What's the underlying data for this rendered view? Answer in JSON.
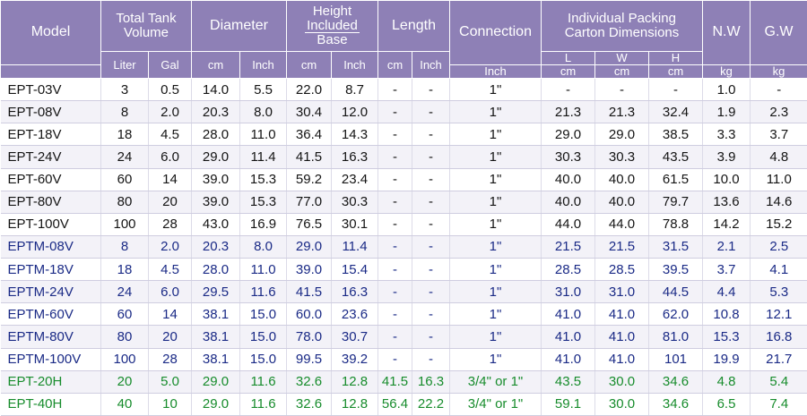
{
  "header": {
    "model": "Model",
    "volume": "Total Tank Volume",
    "diameter": "Diameter",
    "height_line1": "Height",
    "height_line2": "Included",
    "height_line3": "Base",
    "length": "Length",
    "connection": "Connection",
    "packing_line1": "Individual Packing",
    "packing_line2": "Carton Dimensions",
    "nw": "N.W",
    "gw": "G.W",
    "pack_l": "L",
    "pack_w": "W",
    "pack_h": "H",
    "units": [
      "Liter",
      "Gal",
      "cm",
      "Inch",
      "cm",
      "Inch",
      "cm",
      "Inch",
      "Inch",
      "cm",
      "cm",
      "cm",
      "kg",
      "kg"
    ]
  },
  "rows": [
    {
      "model": "EPT-03V",
      "liter": "3",
      "gal": "0.5",
      "dia_cm": "14.0",
      "dia_inch": "5.5",
      "h_cm": "22.0",
      "h_inch": "8.7",
      "len_cm": "-",
      "len_inch": "-",
      "conn": "1\"",
      "pl": "-",
      "pw": "-",
      "ph": "-",
      "nw": "1.0",
      "gw": "-",
      "group": "black"
    },
    {
      "model": "EPT-08V",
      "liter": "8",
      "gal": "2.0",
      "dia_cm": "20.3",
      "dia_inch": "8.0",
      "h_cm": "30.4",
      "h_inch": "12.0",
      "len_cm": "-",
      "len_inch": "-",
      "conn": "1\"",
      "pl": "21.3",
      "pw": "21.3",
      "ph": "32.4",
      "nw": "1.9",
      "gw": "2.3",
      "group": "black"
    },
    {
      "model": "EPT-18V",
      "liter": "18",
      "gal": "4.5",
      "dia_cm": "28.0",
      "dia_inch": "11.0",
      "h_cm": "36.4",
      "h_inch": "14.3",
      "len_cm": "-",
      "len_inch": "-",
      "conn": "1\"",
      "pl": "29.0",
      "pw": "29.0",
      "ph": "38.5",
      "nw": "3.3",
      "gw": "3.7",
      "group": "black"
    },
    {
      "model": "EPT-24V",
      "liter": "24",
      "gal": "6.0",
      "dia_cm": "29.0",
      "dia_inch": "11.4",
      "h_cm": "41.5",
      "h_inch": "16.3",
      "len_cm": "-",
      "len_inch": "-",
      "conn": "1\"",
      "pl": "30.3",
      "pw": "30.3",
      "ph": "43.5",
      "nw": "3.9",
      "gw": "4.8",
      "group": "black"
    },
    {
      "model": "EPT-60V",
      "liter": "60",
      "gal": "14",
      "dia_cm": "39.0",
      "dia_inch": "15.3",
      "h_cm": "59.2",
      "h_inch": "23.4",
      "len_cm": "-",
      "len_inch": "-",
      "conn": "1\"",
      "pl": "40.0",
      "pw": "40.0",
      "ph": "61.5",
      "nw": "10.0",
      "gw": "11.0",
      "group": "black"
    },
    {
      "model": "EPT-80V",
      "liter": "80",
      "gal": "20",
      "dia_cm": "39.0",
      "dia_inch": "15.3",
      "h_cm": "77.0",
      "h_inch": "30.3",
      "len_cm": "-",
      "len_inch": "-",
      "conn": "1\"",
      "pl": "40.0",
      "pw": "40.0",
      "ph": "79.7",
      "nw": "13.6",
      "gw": "14.6",
      "group": "black"
    },
    {
      "model": "EPT-100V",
      "liter": "100",
      "gal": "28",
      "dia_cm": "43.0",
      "dia_inch": "16.9",
      "h_cm": "76.5",
      "h_inch": "30.1",
      "len_cm": "-",
      "len_inch": "-",
      "conn": "1\"",
      "pl": "44.0",
      "pw": "44.0",
      "ph": "78.8",
      "nw": "14.2",
      "gw": "15.2",
      "group": "black"
    },
    {
      "model": "EPTM-08V",
      "liter": "8",
      "gal": "2.0",
      "dia_cm": "20.3",
      "dia_inch": "8.0",
      "h_cm": "29.0",
      "h_inch": "11.4",
      "len_cm": "-",
      "len_inch": "-",
      "conn": "1\"",
      "pl": "21.5",
      "pw": "21.5",
      "ph": "31.5",
      "nw": "2.1",
      "gw": "2.5",
      "group": "blue"
    },
    {
      "model": "EPTM-18V",
      "liter": "18",
      "gal": "4.5",
      "dia_cm": "28.0",
      "dia_inch": "11.0",
      "h_cm": "39.0",
      "h_inch": "15.4",
      "len_cm": "-",
      "len_inch": "-",
      "conn": "1\"",
      "pl": "28.5",
      "pw": "28.5",
      "ph": "39.5",
      "nw": "3.7",
      "gw": "4.1",
      "group": "blue"
    },
    {
      "model": "EPTM-24V",
      "liter": "24",
      "gal": "6.0",
      "dia_cm": "29.5",
      "dia_inch": "11.6",
      "h_cm": "41.5",
      "h_inch": "16.3",
      "len_cm": "-",
      "len_inch": "-",
      "conn": "1\"",
      "pl": "31.0",
      "pw": "31.0",
      "ph": "44.5",
      "nw": "4.4",
      "gw": "5.3",
      "group": "blue"
    },
    {
      "model": "EPTM-60V",
      "liter": "60",
      "gal": "14",
      "dia_cm": "38.1",
      "dia_inch": "15.0",
      "h_cm": "60.0",
      "h_inch": "23.6",
      "len_cm": "-",
      "len_inch": "-",
      "conn": "1\"",
      "pl": "41.0",
      "pw": "41.0",
      "ph": "62.0",
      "nw": "10.8",
      "gw": "12.1",
      "group": "blue"
    },
    {
      "model": "EPTM-80V",
      "liter": "80",
      "gal": "20",
      "dia_cm": "38.1",
      "dia_inch": "15.0",
      "h_cm": "78.0",
      "h_inch": "30.7",
      "len_cm": "-",
      "len_inch": "-",
      "conn": "1\"",
      "pl": "41.0",
      "pw": "41.0",
      "ph": "81.0",
      "nw": "15.3",
      "gw": "16.8",
      "group": "blue"
    },
    {
      "model": "EPTM-100V",
      "liter": "100",
      "gal": "28",
      "dia_cm": "38.1",
      "dia_inch": "15.0",
      "h_cm": "99.5",
      "h_inch": "39.2",
      "len_cm": "-",
      "len_inch": "-",
      "conn": "1\"",
      "pl": "41.0",
      "pw": "41.0",
      "ph": "101",
      "nw": "19.9",
      "gw": "21.7",
      "group": "blue"
    },
    {
      "model": "EPT-20H",
      "liter": "20",
      "gal": "5.0",
      "dia_cm": "29.0",
      "dia_inch": "11.6",
      "h_cm": "32.6",
      "h_inch": "12.8",
      "len_cm": "41.5",
      "len_inch": "16.3",
      "conn": "3/4\" or 1\"",
      "pl": "43.5",
      "pw": "30.0",
      "ph": "34.6",
      "nw": "4.8",
      "gw": "5.4",
      "group": "green"
    },
    {
      "model": "EPT-40H",
      "liter": "40",
      "gal": "10",
      "dia_cm": "29.0",
      "dia_inch": "11.6",
      "h_cm": "32.6",
      "h_inch": "12.8",
      "len_cm": "56.4",
      "len_inch": "22.2",
      "conn": "3/4\" or 1\"",
      "pl": "59.1",
      "pw": "30.0",
      "ph": "34.6",
      "nw": "6.5",
      "gw": "7.4",
      "group": "green"
    }
  ],
  "colors": {
    "header_bg": "#8e80b6",
    "black_rows": "#141414",
    "blue_rows": "#1a2a86",
    "green_rows": "#178c2c"
  }
}
